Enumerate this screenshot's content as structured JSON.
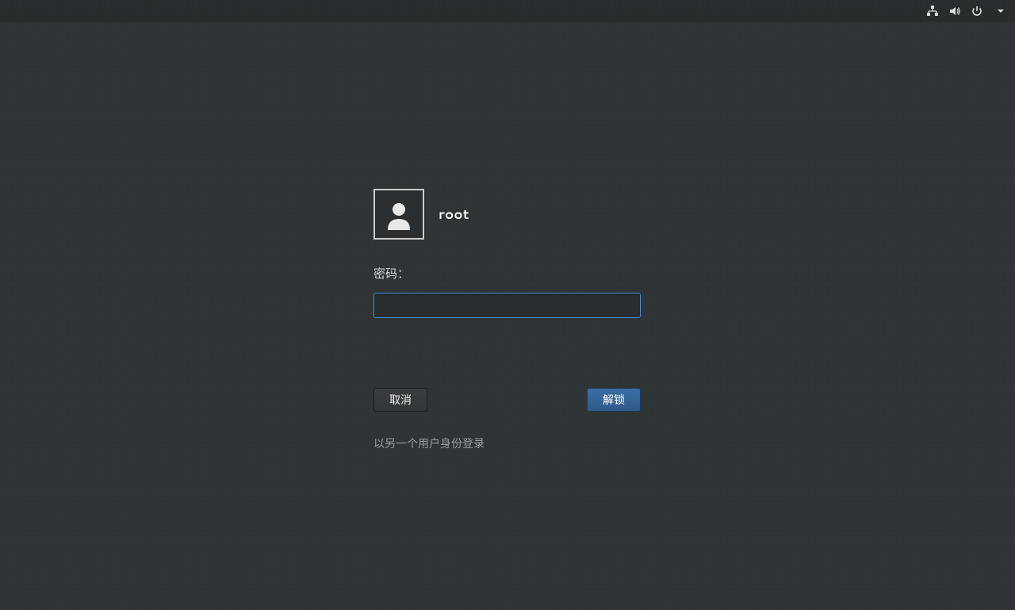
{
  "topbar": {
    "icons": {
      "network": "network-icon",
      "volume": "volume-icon",
      "power": "power-icon",
      "dropdown": "chevron-down-icon"
    }
  },
  "login": {
    "username": "root",
    "password_label": "密码：",
    "password_value": "",
    "buttons": {
      "cancel": "取消",
      "unlock": "解锁"
    },
    "other_user_link": "以另一个用户身份登录"
  }
}
